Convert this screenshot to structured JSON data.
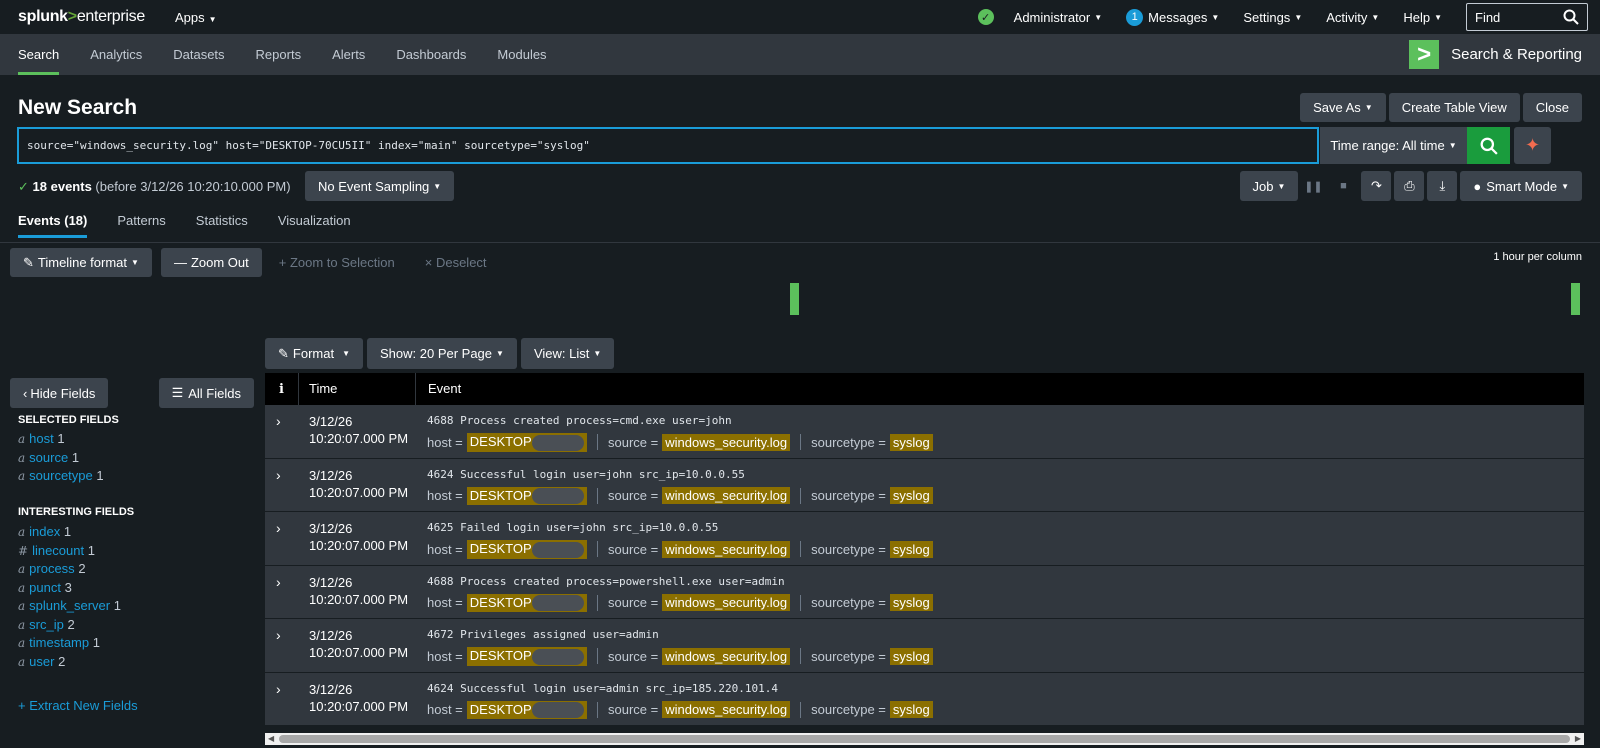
{
  "topbar": {
    "logo_main": "splunk",
    "logo_sep": ">",
    "logo_suffix": "enterprise",
    "apps": "Apps",
    "user": "Administrator",
    "messages_count": "1",
    "messages": "Messages",
    "settings": "Settings",
    "activity": "Activity",
    "help": "Help",
    "find_placeholder": "Find"
  },
  "appbar": {
    "tabs": [
      "Search",
      "Analytics",
      "Datasets",
      "Reports",
      "Alerts",
      "Dashboards",
      "Modules"
    ],
    "app_name": "Search & Reporting"
  },
  "search": {
    "title": "New Search",
    "save_as": "Save As",
    "create_table_view": "Create Table View",
    "close": "Close",
    "query": "source=\"windows_security.log\" host=\"DESKTOP-70CU5II\" index=\"main\" sourcetype=\"syslog\"",
    "time_range": "Time range: All time",
    "event_count": "18 events",
    "before_text": "(before 3/12/26 10:20:10.000 PM)",
    "sampling": "No Event Sampling",
    "job": "Job",
    "mode": "Smart Mode"
  },
  "result_tabs": [
    "Events (18)",
    "Patterns",
    "Statistics",
    "Visualization"
  ],
  "timeline": {
    "format": "Timeline format",
    "zoom_out": "Zoom Out",
    "zoom_selection": "Zoom to Selection",
    "deselect": "Deselect",
    "per_column": "1 hour per column"
  },
  "list_controls": {
    "format": "Format",
    "show": "Show: 20 Per Page",
    "view": "View: List"
  },
  "sidebar": {
    "hide_fields": "Hide Fields",
    "all_fields": "All Fields",
    "selected_header": "SELECTED FIELDS",
    "selected": [
      {
        "type": "a",
        "name": "host",
        "count": "1"
      },
      {
        "type": "a",
        "name": "source",
        "count": "1"
      },
      {
        "type": "a",
        "name": "sourcetype",
        "count": "1"
      }
    ],
    "interesting_header": "INTERESTING FIELDS",
    "interesting": [
      {
        "type": "a",
        "name": "index",
        "count": "1"
      },
      {
        "type": "#",
        "name": "linecount",
        "count": "1"
      },
      {
        "type": "a",
        "name": "process",
        "count": "2"
      },
      {
        "type": "a",
        "name": "punct",
        "count": "3"
      },
      {
        "type": "a",
        "name": "splunk_server",
        "count": "1"
      },
      {
        "type": "a",
        "name": "src_ip",
        "count": "2"
      },
      {
        "type": "a",
        "name": "timestamp",
        "count": "1"
      },
      {
        "type": "a",
        "name": "user",
        "count": "2"
      }
    ],
    "extract": "+ Extract New Fields"
  },
  "table": {
    "col_info": "i",
    "col_time": "Time",
    "col_event": "Event",
    "rows": [
      {
        "date": "3/12/26",
        "time": "10:20:07.000 PM",
        "raw": "4688 Process created process=cmd.exe user=john"
      },
      {
        "date": "3/12/26",
        "time": "10:20:07.000 PM",
        "raw": "4624 Successful login user=john src_ip=10.0.0.55"
      },
      {
        "date": "3/12/26",
        "time": "10:20:07.000 PM",
        "raw": "4625 Failed login user=john src_ip=10.0.0.55"
      },
      {
        "date": "3/12/26",
        "time": "10:20:07.000 PM",
        "raw": "4688 Process created process=powershell.exe user=admin"
      },
      {
        "date": "3/12/26",
        "time": "10:20:07.000 PM",
        "raw": "4672 Privileges assigned user=admin"
      },
      {
        "date": "3/12/26",
        "time": "10:20:07.000 PM",
        "raw": "4624 Successful login user=admin src_ip=185.220.101.4"
      }
    ],
    "meta": {
      "host_label": "host =",
      "host_value": "DESKTOP-",
      "source_label": "source =",
      "source_value": "windows_security.log",
      "sourcetype_label": "sourcetype =",
      "sourcetype_value": "syslog"
    }
  },
  "colors": {
    "accent_green": "#5cc05c",
    "accent_blue": "#1a9cd8",
    "highlight": "#8b6f00"
  }
}
